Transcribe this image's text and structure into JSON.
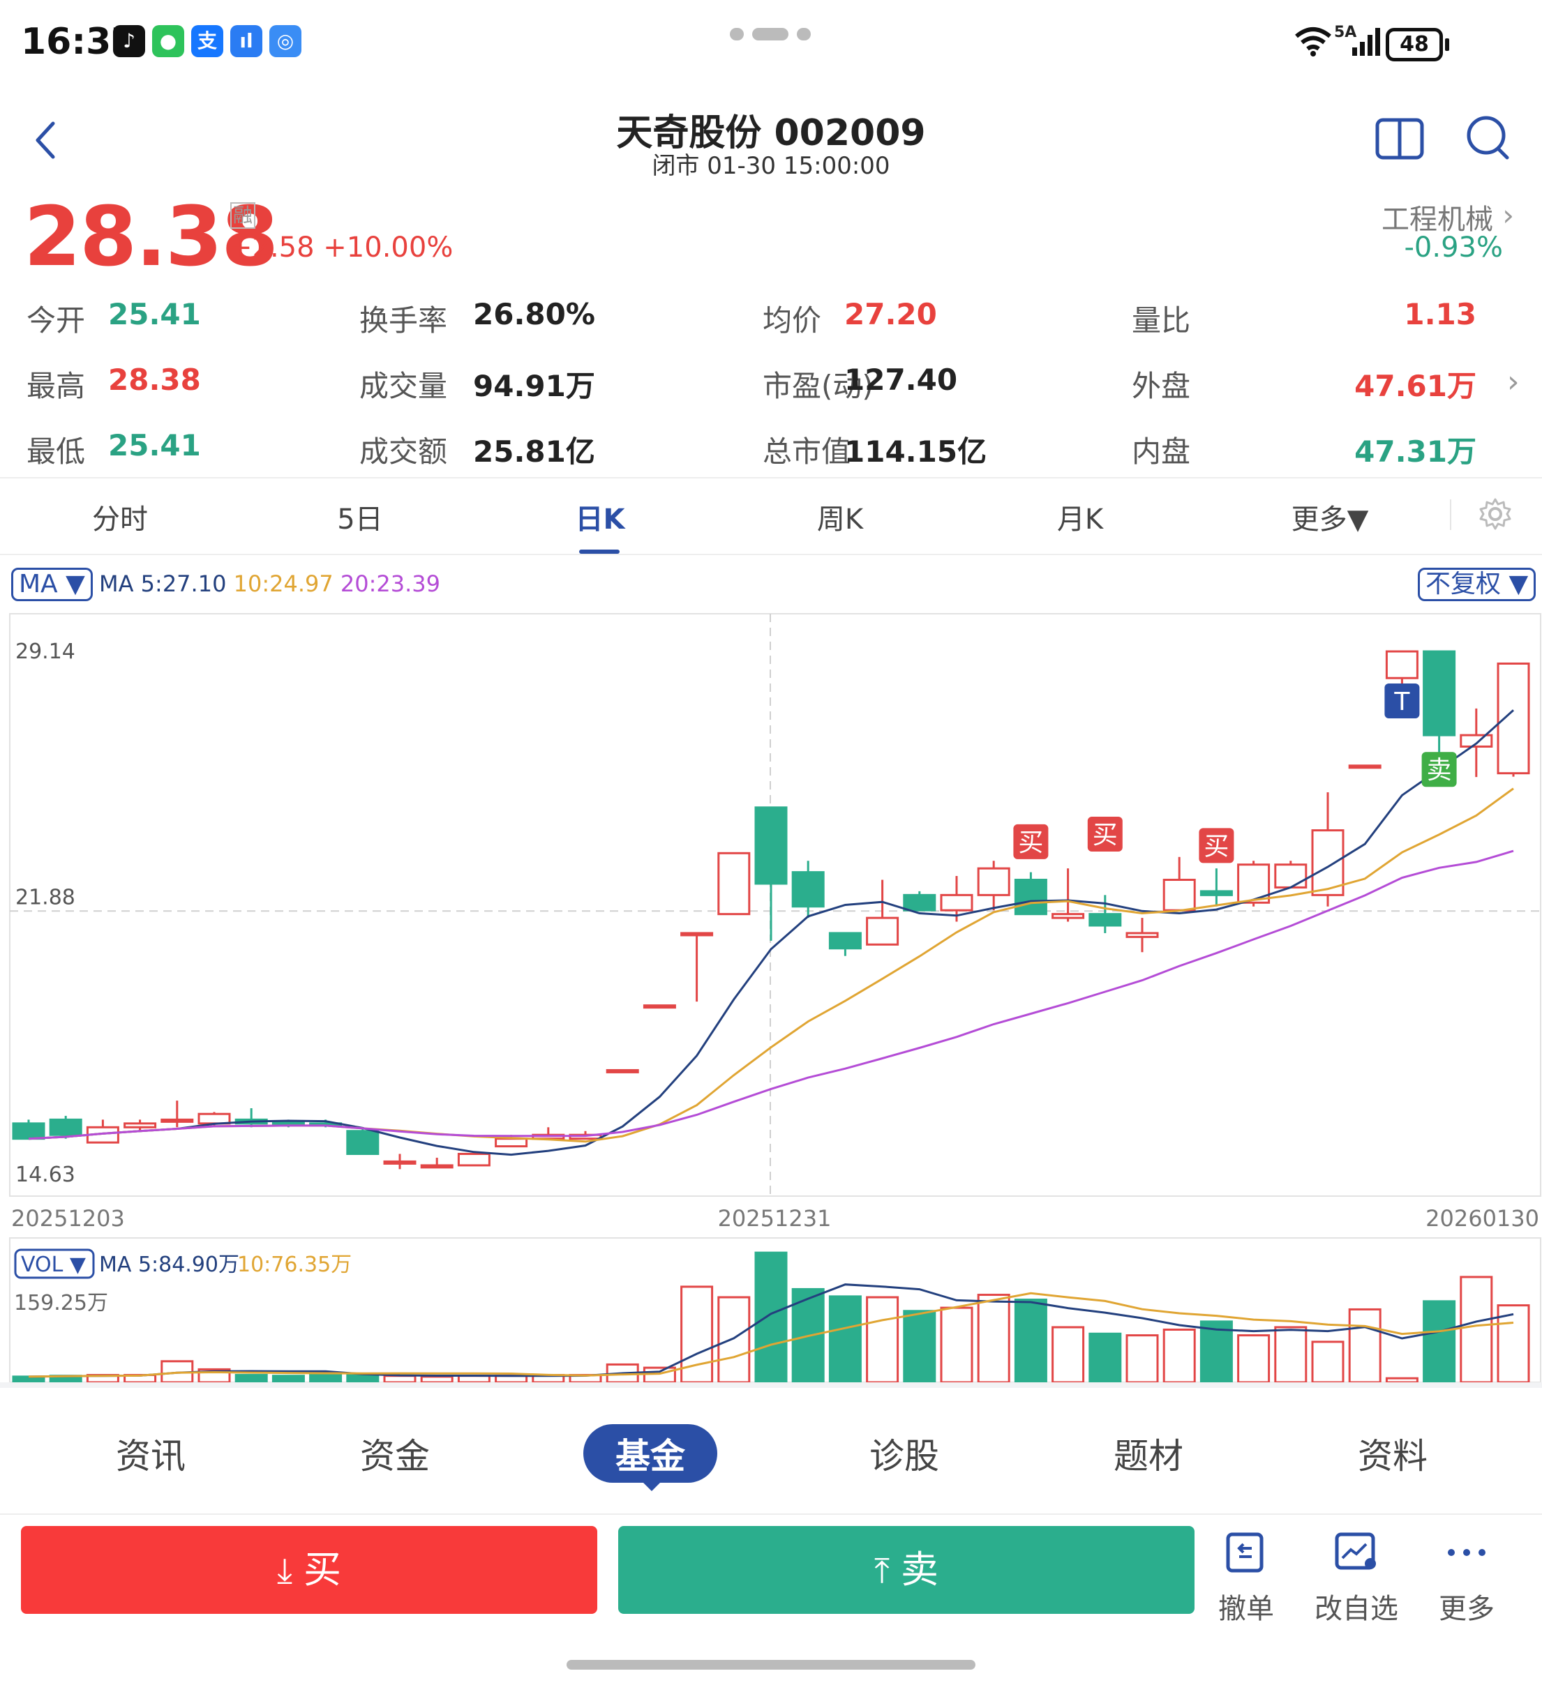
{
  "status_bar": {
    "time": "16:37",
    "battery": "48",
    "network": "5A"
  },
  "header": {
    "title": "天奇股份 002009",
    "subtitle": "闭市 01-30 15:00:00"
  },
  "quote": {
    "price": "28.38",
    "margin_badge": "融",
    "change": "+2.58 +10.00%",
    "industry": "工程机械",
    "industry_change": "-0.93%"
  },
  "stats": [
    {
      "label": "今开",
      "value": "25.41",
      "color": "green"
    },
    {
      "label": "换手率",
      "value": "26.80%",
      "color": "dark"
    },
    {
      "label": "均价",
      "value": "27.20",
      "color": "red"
    },
    {
      "label": "量比",
      "value": "1.13",
      "color": "red"
    },
    {
      "label": "最高",
      "value": "28.38",
      "color": "red"
    },
    {
      "label": "成交量",
      "value": "94.91万",
      "color": "dark"
    },
    {
      "label": "市盈(动)",
      "value": "127.40",
      "color": "dark"
    },
    {
      "label": "外盘",
      "value": "47.61万",
      "color": "red"
    },
    {
      "label": "最低",
      "value": "25.41",
      "color": "green"
    },
    {
      "label": "成交额",
      "value": "25.81亿",
      "color": "dark"
    },
    {
      "label": "总市值",
      "value": "114.15亿",
      "color": "dark"
    },
    {
      "label": "内盘",
      "value": "47.31万",
      "color": "green"
    }
  ],
  "kline_tabs": [
    "分时",
    "5日",
    "日K",
    "周K",
    "月K",
    "更多▼"
  ],
  "kline_active_tab": "日K",
  "ma_indicator": {
    "selector": "MA ▼",
    "ma5": "MA 5:27.10",
    "ma10": "10:24.97",
    "ma20": "20:23.39",
    "adjust": "不复权 ▼"
  },
  "chart_data": {
    "type": "candlestick",
    "y_ticks": [
      "29.14",
      "21.88",
      "14.63"
    ],
    "x_ticks": [
      "20251203",
      "20251231",
      "20260130"
    ],
    "ylim": [
      14.63,
      29.14
    ],
    "candles": [
      {
        "o": 16.3,
        "c": 15.9,
        "h": 16.4,
        "l": 15.9
      },
      {
        "o": 16.4,
        "c": 16.0,
        "h": 16.5,
        "l": 15.9
      },
      {
        "o": 15.8,
        "c": 16.2,
        "h": 16.4,
        "l": 15.8
      },
      {
        "o": 16.2,
        "c": 16.3,
        "h": 16.4,
        "l": 16.1
      },
      {
        "o": 16.35,
        "c": 16.4,
        "h": 16.9,
        "l": 16.2
      },
      {
        "o": 16.3,
        "c": 16.55,
        "h": 16.6,
        "l": 16.2
      },
      {
        "o": 16.4,
        "c": 16.3,
        "h": 16.7,
        "l": 16.2
      },
      {
        "o": 16.35,
        "c": 16.3,
        "h": 16.4,
        "l": 16.2
      },
      {
        "o": 16.3,
        "c": 16.25,
        "h": 16.4,
        "l": 16.2
      },
      {
        "o": 16.1,
        "c": 15.5,
        "h": 16.2,
        "l": 15.5
      },
      {
        "o": 15.3,
        "c": 15.3,
        "h": 15.5,
        "l": 15.1
      },
      {
        "o": 15.2,
        "c": 15.2,
        "h": 15.4,
        "l": 15.2
      },
      {
        "o": 15.2,
        "c": 15.5,
        "h": 15.5,
        "l": 15.2
      },
      {
        "o": 15.7,
        "c": 15.9,
        "h": 16.0,
        "l": 15.7
      },
      {
        "o": 15.9,
        "c": 16.0,
        "h": 16.2,
        "l": 15.9
      },
      {
        "o": 15.9,
        "c": 16.0,
        "h": 16.1,
        "l": 15.9
      },
      {
        "o": 17.7,
        "c": 17.7,
        "h": 17.7,
        "l": 17.7
      },
      {
        "o": 19.4,
        "c": 19.4,
        "h": 19.4,
        "l": 19.4
      },
      {
        "o": 21.3,
        "c": 21.3,
        "h": 21.3,
        "l": 19.5
      },
      {
        "o": 21.8,
        "c": 23.4,
        "h": 23.4,
        "l": 21.8
      },
      {
        "o": 24.6,
        "c": 22.6,
        "h": 24.6,
        "l": 21.1
      },
      {
        "o": 22.9,
        "c": 22.0,
        "h": 23.2,
        "l": 21.7
      },
      {
        "o": 21.3,
        "c": 20.9,
        "h": 21.3,
        "l": 20.7
      },
      {
        "o": 21.0,
        "c": 21.7,
        "h": 22.7,
        "l": 21.0
      },
      {
        "o": 22.3,
        "c": 21.9,
        "h": 22.4,
        "l": 21.9
      },
      {
        "o": 21.9,
        "c": 22.3,
        "h": 22.8,
        "l": 21.6
      },
      {
        "o": 22.3,
        "c": 23.0,
        "h": 23.2,
        "l": 21.9
      },
      {
        "o": 22.7,
        "c": 21.8,
        "h": 22.9,
        "l": 21.8
      },
      {
        "o": 21.7,
        "c": 21.8,
        "h": 23.0,
        "l": 21.6
      },
      {
        "o": 21.8,
        "c": 21.5,
        "h": 22.3,
        "l": 21.3
      },
      {
        "o": 21.2,
        "c": 21.3,
        "h": 21.7,
        "l": 20.8
      },
      {
        "o": 21.9,
        "c": 22.7,
        "h": 23.3,
        "l": 21.9
      },
      {
        "o": 22.4,
        "c": 22.3,
        "h": 23.0,
        "l": 22.0
      },
      {
        "o": 22.1,
        "c": 23.1,
        "h": 23.2,
        "l": 22.0
      },
      {
        "o": 22.5,
        "c": 23.1,
        "h": 23.2,
        "l": 22.5
      },
      {
        "o": 22.3,
        "c": 24.0,
        "h": 25.0,
        "l": 22.0
      },
      {
        "o": 25.7,
        "c": 25.7,
        "h": 25.7,
        "l": 25.7
      },
      {
        "o": 28.0,
        "c": 28.7,
        "h": 28.7,
        "l": 27.7
      },
      {
        "o": 28.7,
        "c": 26.5,
        "h": 28.7,
        "l": 26.0
      },
      {
        "o": 26.2,
        "c": 26.5,
        "h": 27.2,
        "l": 25.4
      },
      {
        "o": 25.5,
        "c": 28.38,
        "h": 28.38,
        "l": 25.41
      }
    ],
    "signals": [
      "买",
      "买",
      "买",
      "T",
      "卖"
    ],
    "volume": {
      "selector": "VOL ▼",
      "ma5": "MA 5:84.90万",
      "ma10": "10:76.35万",
      "max_label": "159.25万",
      "values": [
        7,
        8,
        9,
        9,
        26,
        16,
        9,
        8,
        9,
        9,
        8,
        7,
        8,
        8,
        9,
        9,
        22,
        18,
        118,
        105,
        160,
        115,
        106,
        105,
        88,
        92,
        108,
        102,
        68,
        60,
        58,
        65,
        75,
        58,
        68,
        50,
        90,
        5,
        100,
        130,
        95
      ]
    },
    "series": [
      {
        "name": "MA 5",
        "color": "#23407e"
      },
      {
        "name": "10",
        "color": "#e0a533"
      },
      {
        "name": "20",
        "color": "#b44cd6"
      }
    ]
  },
  "bottom_tabs": [
    "资讯",
    "资金",
    "基金",
    "诊股",
    "题材",
    "资料"
  ],
  "bottom_active": "基金",
  "trade": {
    "buy": "买",
    "sell": "卖",
    "tools": [
      "撤单",
      "改自选",
      "更多"
    ]
  }
}
